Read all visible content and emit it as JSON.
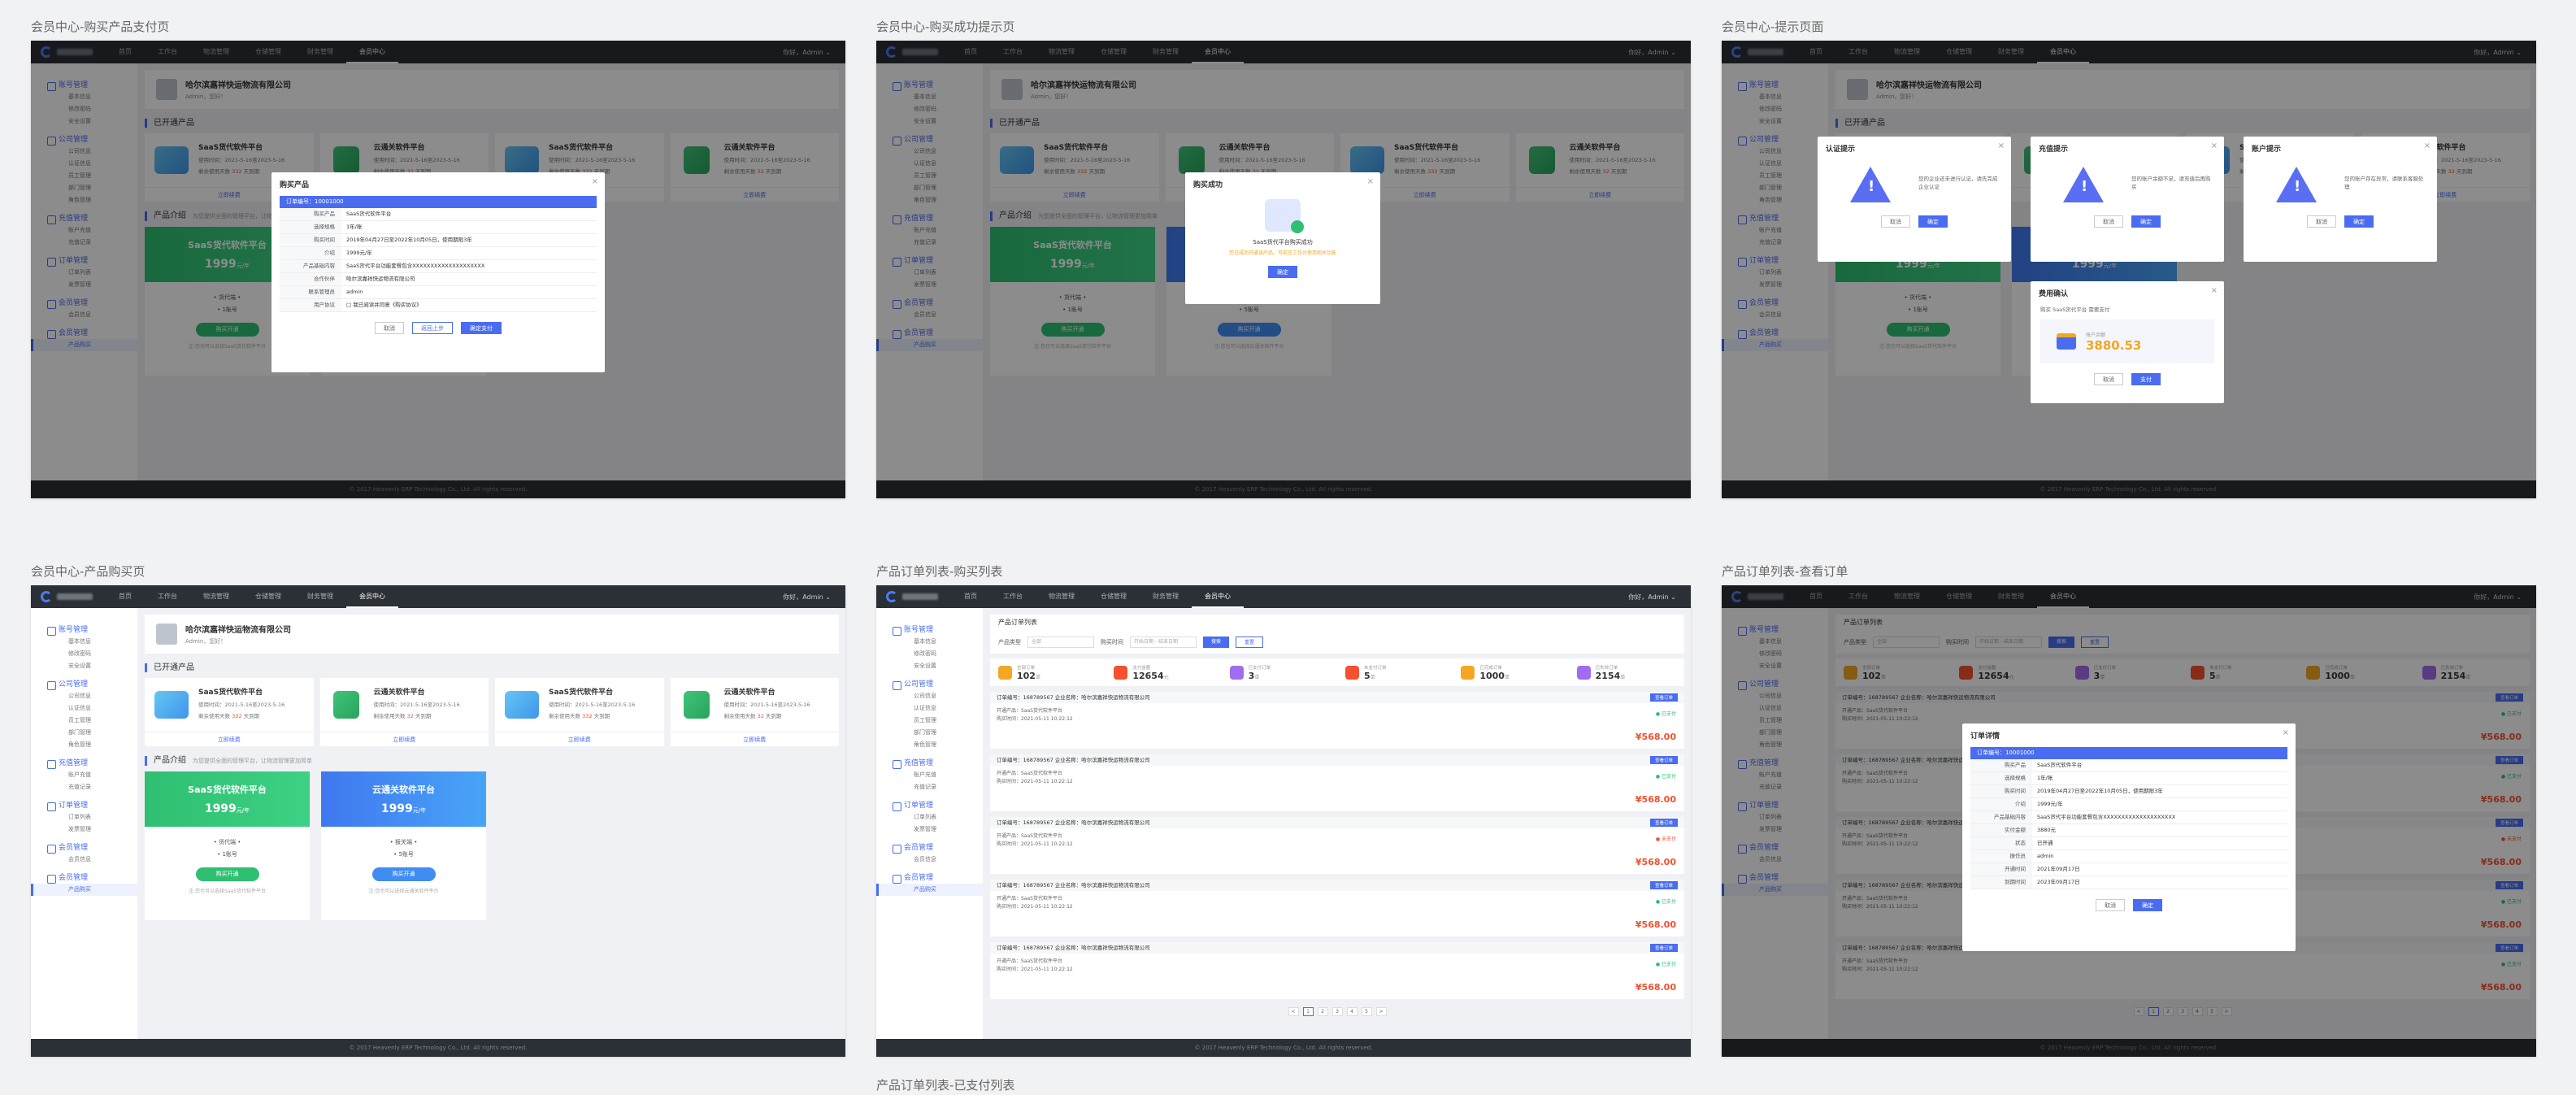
{
  "board_titles": {
    "f1": "会员中心-购买产品支付页",
    "f2": "会员中心-购买成功提示页",
    "f3": "会员中心-提示页面",
    "f4": "会员中心-产品购买页",
    "f5": "产品订单列表-购买列表",
    "f6": "产品订单列表-查看订单",
    "f7": "产品订单列表-已支付列表"
  },
  "nav": [
    "首页",
    "工作台",
    "物流管理",
    "仓储管理",
    "财务管理",
    "会员中心"
  ],
  "user_label": "你好，Admin ⌄",
  "sidebar": {
    "groups": [
      {
        "label": "账号管理",
        "subs": [
          "基本信息",
          "修改密码",
          "安全设置"
        ]
      },
      {
        "label": "公司管理",
        "subs": [
          "公司信息",
          "认证信息",
          "员工管理",
          "部门管理",
          "角色管理"
        ]
      },
      {
        "label": "充值管理",
        "subs": [
          "账户充值",
          "充值记录"
        ]
      },
      {
        "label": "订单管理",
        "subs": [
          "订单列表",
          "发票管理"
        ]
      },
      {
        "label": "会员管理",
        "subs": [
          "会员信息"
        ]
      },
      {
        "label": "会员管理",
        "subs": [
          "产品购买"
        ]
      }
    ]
  },
  "company": {
    "name": "哈尔滨嘉祥快运物流有限公司",
    "sub": "Admin，您好！"
  },
  "sections": {
    "opened": "已开通产品",
    "intro": "产品介绍",
    "intro_tip": "为您提供全面的管理平台，让物流管理更加简单"
  },
  "opened_products": [
    {
      "title": "SaaS货代软件平台",
      "line1": "使用时间：2021-5-16至2023-5-16",
      "line2_a": "剩余使用天数 ",
      "days": "332",
      "line2_b": " 天到期",
      "link": "立即续费"
    },
    {
      "title": "云通关软件平台",
      "line1": "使用时间：2021-5-16至2023-5-16",
      "line2_a": "剩余使用天数 ",
      "days": "32",
      "line2_b": " 天到期",
      "link": "立即续费"
    },
    {
      "title": "SaaS货代软件平台",
      "line1": "使用时间：2021-5-16至2023-5-16",
      "line2_a": "剩余使用天数 ",
      "days": "332",
      "line2_b": " 天到期",
      "link": "立即续费"
    },
    {
      "title": "云通关软件平台",
      "line1": "使用时间：2021-5-16至2023-5-16",
      "line2_a": "剩余使用天数 ",
      "days": "32",
      "line2_b": " 天到期",
      "link": "立即续费"
    }
  ],
  "products": [
    {
      "name": "SaaS货代软件平台",
      "price": "1999",
      "unit": "元/年",
      "f1": "• 货代端 •",
      "f2": "• 1账号",
      "buy": "购买开通",
      "tip": "注:您也可以选择SaaS货代软件平台"
    },
    {
      "name": "云通关软件平台",
      "price": "1999",
      "unit": "元/年",
      "f1": "• 报关端 •",
      "f2": "• 5账号",
      "buy": "购买开通",
      "tip": "注:您也可以选择云通关软件平台"
    }
  ],
  "buy_modal": {
    "title": "购买产品",
    "bar": "订单编号：10001000",
    "rows": [
      {
        "k": "购买产品",
        "v": "SaaS货代软件平台"
      },
      {
        "k": "选择规格",
        "v": "1年/账"
      },
      {
        "k": "购买时间",
        "v": "2019年04月27日至2022年10月05日，使用期限3年"
      },
      {
        "k": "介绍",
        "v": "1999元/年"
      },
      {
        "k": "产品基础内容",
        "v": "SaaS货代平台功能套餐包含XXXXXXXXXXXXXXXXXXXX"
      },
      {
        "k": "合作伙伴",
        "v": "哈尔滨嘉祥快运物流有限公司"
      },
      {
        "k": "联系管理员",
        "v": "admin"
      },
      {
        "k": "用户协议",
        "v": "□ 我已阅读并同意《购买协议》"
      }
    ],
    "cancel": "取消",
    "back": "返回上步",
    "pay": "确定支付"
  },
  "success_modal": {
    "title": "购买成功",
    "msg": "SaaS货代平台购买成功",
    "sub": "您已成功开通该产品，可前往工作台使用相关功能",
    "ok": "确定"
  },
  "tips": [
    {
      "title": "认证提示",
      "msg": "您的企业还未进行认证，请先完成企业认证",
      "cancel": "取消",
      "ok": "确定"
    },
    {
      "title": "充值提示",
      "msg": "您的账户余额不足，请充值后再购买",
      "cancel": "取消",
      "ok": "确定"
    },
    {
      "title": "账户提示",
      "msg": "您的账户存在异常，请联系客服处理",
      "cancel": "取消",
      "ok": "确定"
    }
  ],
  "fee_confirm": {
    "title": "费用确认",
    "msg": "购买 SaaS货代平台 需要支付",
    "balance_label": "账户余额",
    "amount": "3880.53",
    "cancel": "取消",
    "ok": "支付"
  },
  "order_list": {
    "page_title": "产品订单列表",
    "filter_type": "产品类型",
    "filter_select": "全部",
    "filter_time": "购买时间",
    "filter_date": "开始日期 - 结束日期",
    "search": "搜索",
    "reset": "重置",
    "stats": [
      {
        "label": "全部订单",
        "value": "102",
        "unit": "单",
        "color": "#f5a623"
      },
      {
        "label": "支付金额",
        "value": "12654",
        "unit": "元",
        "color": "#f5502f"
      },
      {
        "label": "已支付订单",
        "value": "3",
        "unit": "单",
        "color": "#a06cf0"
      },
      {
        "label": "未支付订单",
        "value": "5",
        "unit": "单",
        "color": "#f5502f"
      },
      {
        "label": "已完成订单",
        "value": "1000",
        "unit": "单",
        "color": "#f5a623"
      },
      {
        "label": "已失效订单",
        "value": "2154",
        "unit": "单",
        "color": "#a06cf0"
      }
    ],
    "orders": [
      {
        "head": "订单编号：168789567    企业名称：哈尔滨嘉祥快运物流有限公司",
        "line1": "开通产品：SaaS货代软件平台",
        "line2": "购买时间：2021-05-11 10:22:12",
        "status": "● 已支付",
        "price": "¥568.00",
        "tag": "查看订单"
      },
      {
        "head": "订单编号：168789567    企业名称：哈尔滨嘉祥快运物流有限公司",
        "line1": "开通产品：SaaS货代软件平台",
        "line2": "购买时间：2021-05-11 10:22:12",
        "status": "● 已支付",
        "price": "¥568.00",
        "tag": "查看订单"
      },
      {
        "head": "订单编号：168789567    企业名称：哈尔滨嘉祥快运物流有限公司",
        "line1": "开通产品：SaaS货代软件平台",
        "line2": "购买时间：2021-05-11 10:22:12",
        "status": "● 未支付",
        "price": "¥568.00",
        "tag": "查看订单"
      },
      {
        "head": "订单编号：168789567    企业名称：哈尔滨嘉祥快运物流有限公司",
        "line1": "开通产品：SaaS货代软件平台",
        "line2": "购买时间：2021-05-11 10:22:12",
        "status": "● 已支付",
        "price": "¥568.00",
        "tag": "查看订单"
      },
      {
        "head": "订单编号：168789567    企业名称：哈尔滨嘉祥快运物流有限公司",
        "line1": "开通产品：SaaS货代软件平台",
        "line2": "购买时间：2021-05-11 10:22:12",
        "status": "● 已支付",
        "price": "¥568.00",
        "tag": "查看订单"
      }
    ],
    "pages": [
      "<",
      "1",
      "2",
      "3",
      "4",
      "5",
      ">"
    ]
  },
  "order_detail": {
    "title": "订单详情",
    "bar": "订单编号：10001000",
    "rows": [
      {
        "k": "购买产品",
        "v": "SaaS货代软件平台"
      },
      {
        "k": "选择规格",
        "v": "1年/账"
      },
      {
        "k": "购买时间",
        "v": "2019年04月27日至2022年10月05日，使用期限3年"
      },
      {
        "k": "介绍",
        "v": "1999元/年"
      },
      {
        "k": "产品基础内容",
        "v": "SaaS货代平台功能套餐包含XXXXXXXXXXXXXXXXXXXX"
      },
      {
        "k": "实付金额",
        "v": "3880元"
      },
      {
        "k": "状态",
        "v": "已开通"
      },
      {
        "k": "操作员",
        "v": "admin"
      },
      {
        "k": "开通时间",
        "v": "2021年09月17日"
      },
      {
        "k": "到期时间",
        "v": "2023年09月17日"
      }
    ],
    "cancel": "取消",
    "ok": "确定"
  },
  "footer": "© 2017 Heavenly ERP Technology Co., Ltd. All rights reserved."
}
